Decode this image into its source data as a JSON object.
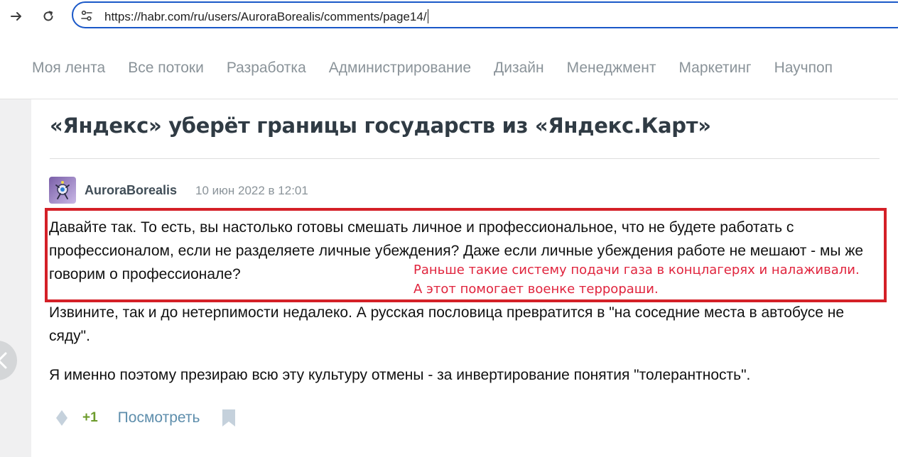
{
  "browser": {
    "url": "https://habr.com/ru/users/AuroraBorealis/comments/page14/",
    "icons": {
      "forward": "arrow-right-icon",
      "reload": "reload-icon",
      "site_settings": "tune-icon"
    }
  },
  "sitenav": {
    "items": [
      "Моя лента",
      "Все потоки",
      "Разработка",
      "Администрирование",
      "Дизайн",
      "Менеджмент",
      "Маркетинг",
      "Научпоп"
    ]
  },
  "post": {
    "title": "«Яндекс» уберёт границы государств из «Яндекс.Карт»"
  },
  "comment": {
    "author": "AuroraBorealis",
    "date": "10 июн 2022 в 12:01",
    "paragraphs": [
      "Давайте так. То есть, вы настолько готовы смешать личное и профессиональное, что не будете работать с профессионалом, если не разделяете личные убеждения? Даже если личные убеждения работе не мешают - мы же говорим о профессионале?",
      "Извините, так и до нетерпимости недалеко. А русская пословица превратится в \"на соседние места в автобусе не сяду\".",
      "Я именно поэтому презираю всю эту культуру отмены - за инвертирование понятия \"толерантность\"."
    ],
    "score": "+1",
    "view_label": "Посмотреть"
  },
  "annotation": {
    "line1": "Раньше такие систему подачи газа в концлагерях и налаживали.",
    "line2": "А этот помогает военке террораши.",
    "color": "#e0243d",
    "box_color": "#d42027"
  }
}
